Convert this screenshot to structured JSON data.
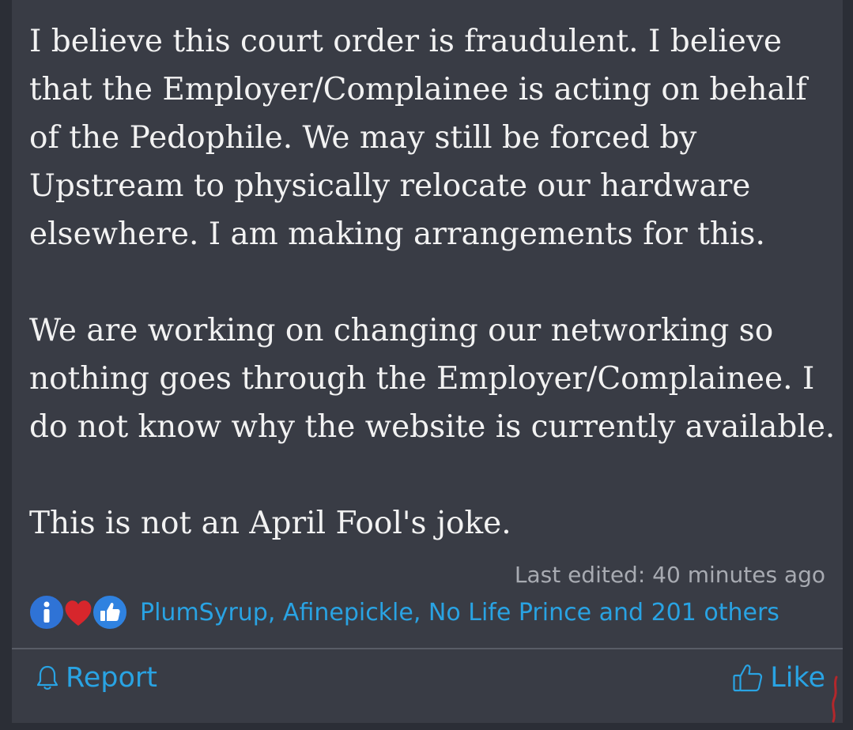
{
  "post": {
    "paragraphs": [
      "I believe this court order is fraudulent. I believe that the Employer/Complainee is acting on behalf of the Pedophile. We may still be forced by Upstream to physically relocate our hardware elsewhere. I am making arrangements for this.",
      "We are working on changing our networking so nothing goes through the Employer/Complainee. I do not know why the website is currently available.",
      "This is not an April Fool's joke."
    ],
    "last_edited": "Last edited: 40 minutes ago"
  },
  "reactions": {
    "icons": [
      "info-icon",
      "heart-icon",
      "thumbs-up-icon"
    ],
    "summary": "PlumSyrup, Afinepickle, No Life Prince and 201 others"
  },
  "actions": {
    "report_label": "Report",
    "like_label": "Like"
  },
  "colors": {
    "background": "#393c45",
    "text": "#f2f2f2",
    "link": "#29a3e3",
    "muted": "#a8abb2"
  }
}
